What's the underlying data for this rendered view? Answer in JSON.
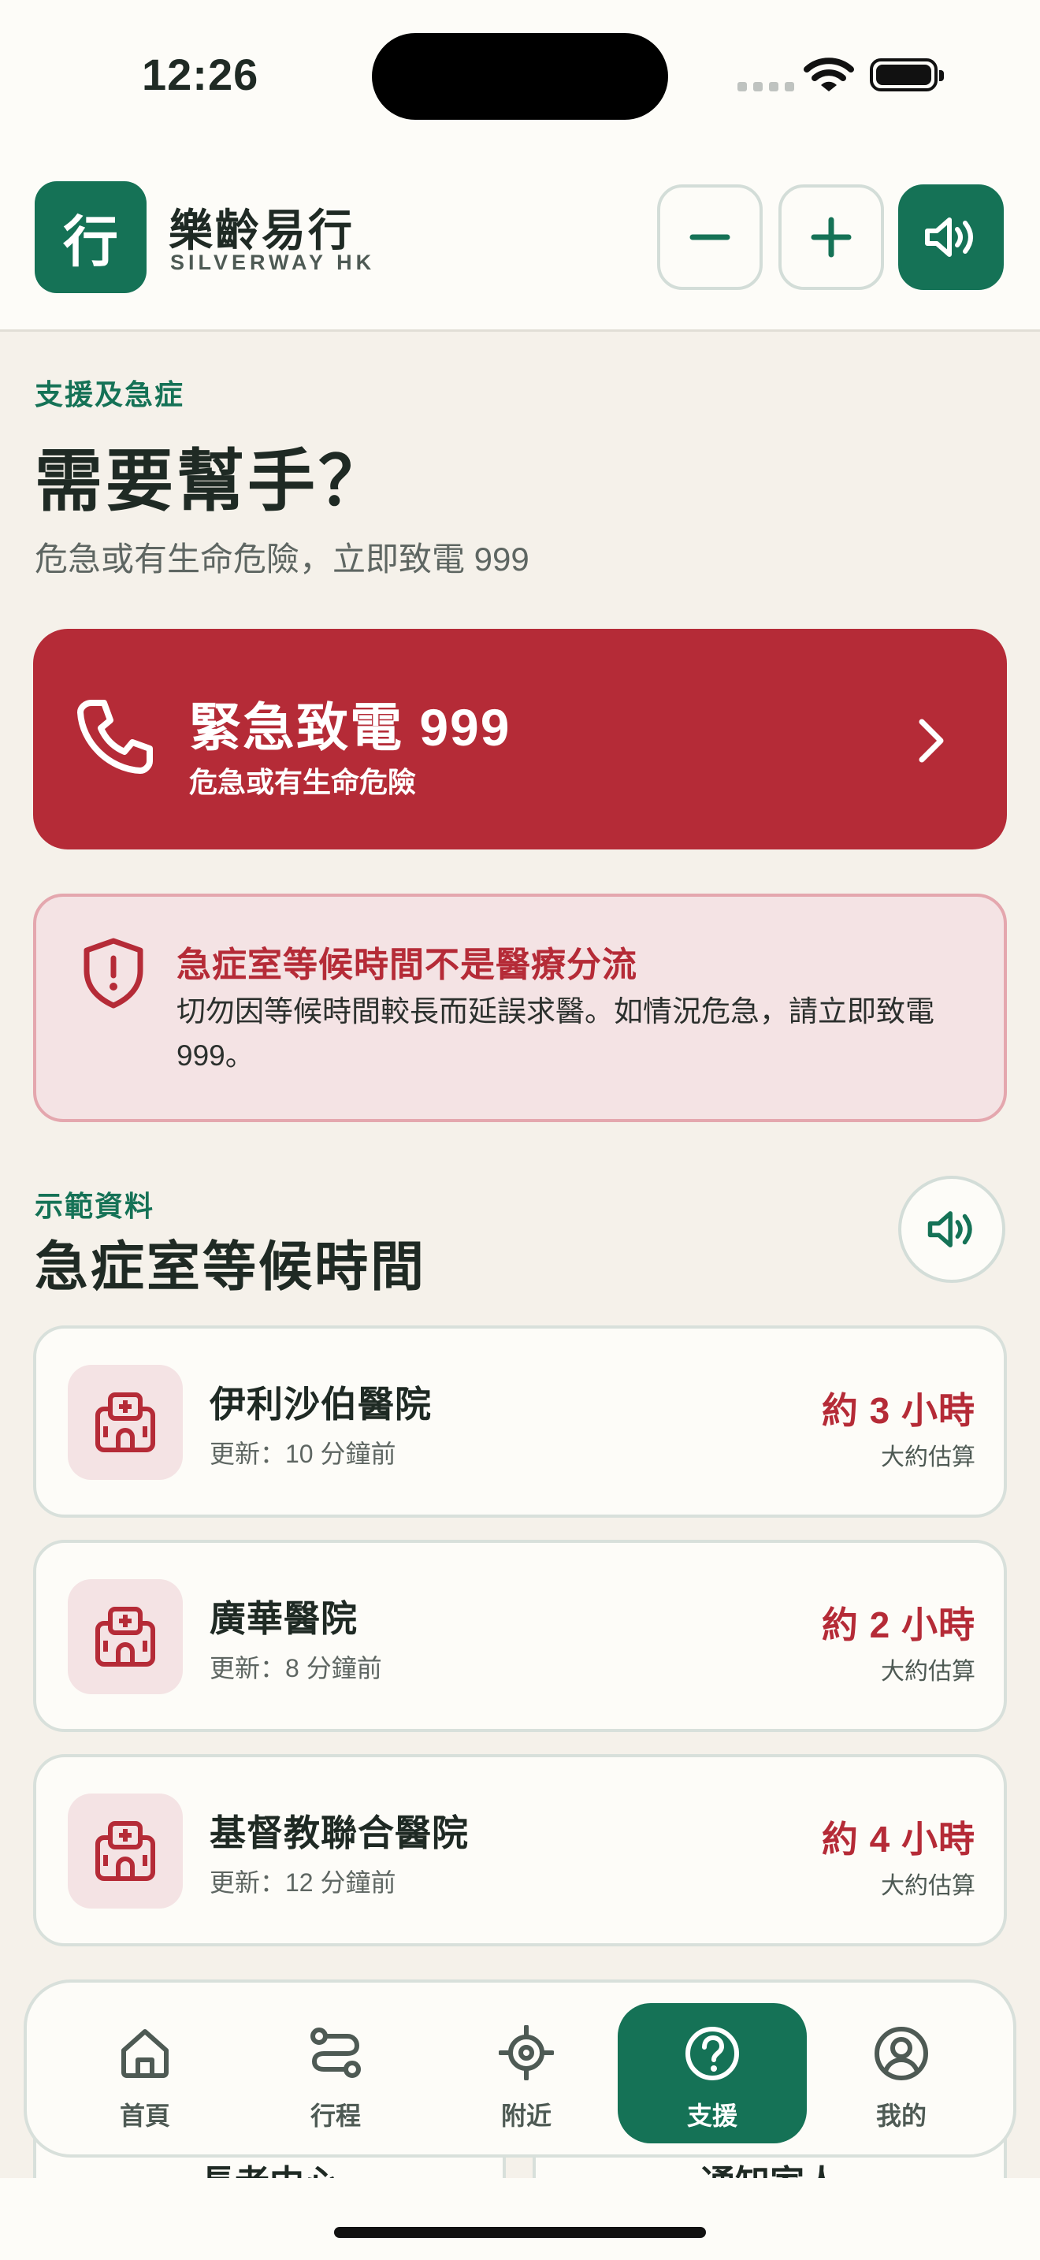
{
  "status_bar": {
    "time": "12:26"
  },
  "header": {
    "logo_char": "行",
    "app_name": "樂齡易行",
    "app_subtitle": "SILVERWAY HK"
  },
  "intro": {
    "eyebrow": "支援及急症",
    "title": "需要幫手？",
    "subtitle": "危急或有生命危險，立即致電 999"
  },
  "emergency_call": {
    "title": "緊急致電 999",
    "description": "危急或有生命危險"
  },
  "warning": {
    "title": "急症室等候時間不是醫療分流",
    "body": "切勿因等候時間較長而延誤求醫。如情況危急，請立即致電 999。"
  },
  "wait_section": {
    "eyebrow": "示範資料",
    "title": "急症室等候時間",
    "hospitals": [
      {
        "name": "伊利沙伯醫院",
        "updated": "更新：10 分鐘前",
        "wait": "約 3 小時",
        "note": "大約估算"
      },
      {
        "name": "廣華醫院",
        "updated": "更新：8 分鐘前",
        "wait": "約 2 小時",
        "note": "大約估算"
      },
      {
        "name": "基督教聯合醫院",
        "updated": "更新：12 分鐘前",
        "wait": "約 4 小時",
        "note": "大約估算"
      }
    ]
  },
  "peek_cards": [
    "長者中心",
    "通知家人"
  ],
  "tab_bar": {
    "active": "support",
    "tabs": [
      {
        "id": "home",
        "label": "首頁",
        "icon": "home-icon"
      },
      {
        "id": "trips",
        "label": "行程",
        "icon": "route-icon"
      },
      {
        "id": "nearby",
        "label": "附近",
        "icon": "locate-icon"
      },
      {
        "id": "support",
        "label": "支援",
        "icon": "help-icon"
      },
      {
        "id": "me",
        "label": "我的",
        "icon": "user-icon"
      }
    ]
  },
  "colors": {
    "brand_green": "#157256",
    "emergency_red": "#B52B37",
    "warning_bg": "#F4E3E4",
    "page_bg": "#F5F1EA"
  }
}
